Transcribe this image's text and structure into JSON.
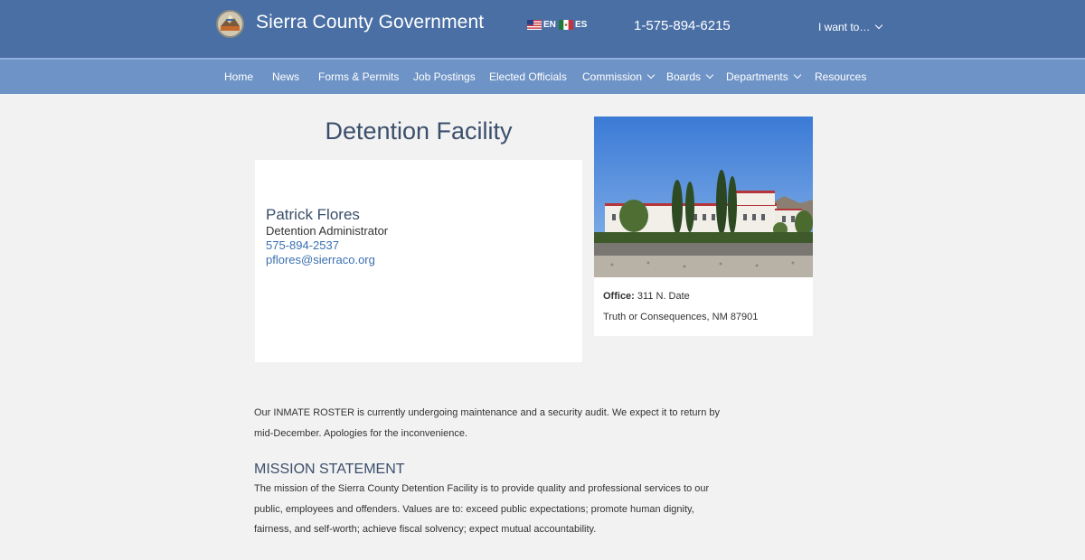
{
  "header": {
    "site_title": "Sierra County Government",
    "languages": [
      {
        "code": "EN",
        "flag": "us-flag-icon"
      },
      {
        "code": "ES",
        "flag": "mexico-flag-icon"
      }
    ],
    "phone": "1-575-894-6215",
    "i_want_to": "I want to…"
  },
  "nav": {
    "items": [
      {
        "label": "Home",
        "dropdown": false
      },
      {
        "label": "News",
        "dropdown": false
      },
      {
        "label": "Forms & Permits",
        "dropdown": false
      },
      {
        "label": "Job Postings",
        "dropdown": false
      },
      {
        "label": "Elected Officials",
        "dropdown": false
      },
      {
        "label": "Commission",
        "dropdown": true
      },
      {
        "label": "Boards",
        "dropdown": true
      },
      {
        "label": "Departments",
        "dropdown": true
      },
      {
        "label": "Resources",
        "dropdown": false
      }
    ]
  },
  "main": {
    "title": "Detention Facility",
    "contact": {
      "name": "Patrick Flores",
      "role": "Detention Administrator",
      "phone": "575-894-2537",
      "email": "pflores@sierraco.org"
    },
    "office": {
      "label": "Office:",
      "street": "311 N. Date",
      "city": "Truth or Consequences, NM 87901"
    },
    "notice": "Our INMATE ROSTER is currently undergoing maintenance and a security audit. We expect it to return by mid-December. Apologies for the inconvenience.",
    "mission_heading": "MISSION STATEMENT",
    "mission_text": "The mission of the Sierra County Detention Facility is to provide quality and professional services to our public, employees and offenders. Values are to: exceed public expectations; promote human dignity, fairness, and self-worth; achieve fiscal solvency; expect mutual accountability."
  },
  "colors": {
    "header_bg": "#4a6fa5",
    "nav_bg": "#6e93c6",
    "page_bg": "#f2f2f2",
    "heading": "#3b4f6b",
    "link": "#3a6fb0"
  }
}
